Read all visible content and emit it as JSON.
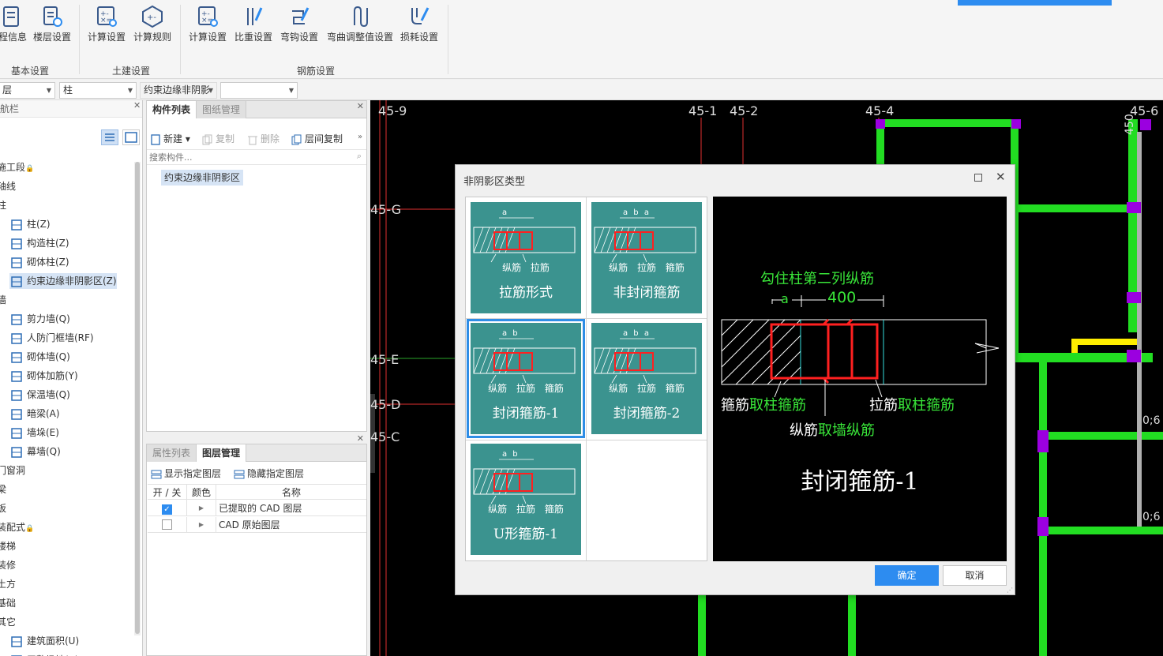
{
  "ribbon": {
    "groups": [
      {
        "label": "基本设置",
        "buttons": [
          "程信息",
          "楼层设置"
        ]
      },
      {
        "label": "土建设置",
        "buttons": [
          "计算设置",
          "计算规则"
        ]
      },
      {
        "label": "钢筋设置",
        "buttons": [
          "计算设置",
          "比重设置",
          "弯钩设置",
          "弯曲调整值设置",
          "损耗设置"
        ]
      }
    ]
  },
  "toolbar": {
    "floor": "层",
    "type": "柱",
    "component": "约束边缘非阴影",
    "empty": ""
  },
  "nav": {
    "title": "航栏",
    "items": [
      {
        "label": "施工段",
        "lock": "🔒"
      },
      {
        "label": "轴线"
      },
      {
        "label": "柱"
      },
      {
        "label": "柱(Z)"
      },
      {
        "label": "构造柱(Z)"
      },
      {
        "label": "砌体柱(Z)"
      },
      {
        "label": "约束边缘非阴影区(Z)"
      },
      {
        "label": "墙"
      },
      {
        "label": "剪力墙(Q)"
      },
      {
        "label": "人防门框墙(RF)"
      },
      {
        "label": "砌体墙(Q)"
      },
      {
        "label": "砌体加筋(Y)"
      },
      {
        "label": "保温墙(Q)"
      },
      {
        "label": "暗梁(A)"
      },
      {
        "label": "墙垛(E)"
      },
      {
        "label": "幕墙(Q)"
      },
      {
        "label": "门窗洞"
      },
      {
        "label": "梁"
      },
      {
        "label": "板"
      },
      {
        "label": "装配式",
        "lock": "🔒"
      },
      {
        "label": "楼梯"
      },
      {
        "label": "装修"
      },
      {
        "label": "土方"
      },
      {
        "label": "基础"
      },
      {
        "label": "其它"
      },
      {
        "label": "建筑面积(U)"
      },
      {
        "label": "平整场地(V)"
      }
    ]
  },
  "component_panel": {
    "tabs": [
      "构件列表",
      "图纸管理"
    ],
    "tools": [
      "新建",
      "复制",
      "删除",
      "层间复制"
    ],
    "search_placeholder": "搜索构件...",
    "items": [
      "约束边缘非阴影区"
    ]
  },
  "property_panel": {
    "tabs": [
      "属性列表",
      "图层管理"
    ],
    "actions": [
      "显示指定图层",
      "隐藏指定图层"
    ],
    "columns": [
      "开 / 关",
      "颜色",
      "名称"
    ],
    "rows": [
      {
        "checked": true,
        "name": "已提取的 CAD 图层"
      },
      {
        "checked": false,
        "name": "CAD 原始图层"
      }
    ]
  },
  "cad": {
    "axis_top": [
      "45-9",
      "45-1",
      "45-2",
      "45-4",
      "45-6"
    ],
    "axis_left": [
      "45-G",
      "45-E",
      "45-D",
      "45-C"
    ],
    "dims": [
      "450",
      "0;6",
      "0;6"
    ]
  },
  "dialog": {
    "title": "非阴影区类型",
    "options": [
      {
        "label": "拉筋形式",
        "dims": "a",
        "notes": [
          "纵筋",
          "拉筋"
        ]
      },
      {
        "label": "非封闭箍筋",
        "dims": "a b a",
        "notes": [
          "纵筋",
          "拉筋",
          "箍筋"
        ]
      },
      {
        "label": "封闭箍筋-1",
        "dims": "a b",
        "notes": [
          "纵筋",
          "拉筋",
          "箍筋"
        ]
      },
      {
        "label": "封闭箍筋-2",
        "dims": "a b a",
        "notes": [
          "纵筋",
          "拉筋",
          "箍筋"
        ]
      },
      {
        "label": "U形箍筋-1",
        "dims": "a b",
        "notes": [
          "纵筋",
          "拉筋",
          "箍筋"
        ]
      }
    ],
    "selected_index": 2,
    "preview": {
      "top_note": "勾住柱第二列纵筋",
      "dim_a": "a",
      "dim_b": "400",
      "stirrup": "箍筋",
      "stirrup_src": "取柱箍筋",
      "tie": "拉筋",
      "tie_src": "取柱箍筋",
      "long": "纵筋",
      "long_src": "取墙纵筋",
      "title": "封闭箍筋-1"
    },
    "ok": "确定",
    "cancel": "取消"
  },
  "colors": {
    "accent": "#2d8cf0",
    "tile": "#3b938f",
    "rebar": "#ff2020",
    "cad_green": "#22dd22",
    "cad_purple": "#9b00e0",
    "text_green": "#39e639"
  }
}
